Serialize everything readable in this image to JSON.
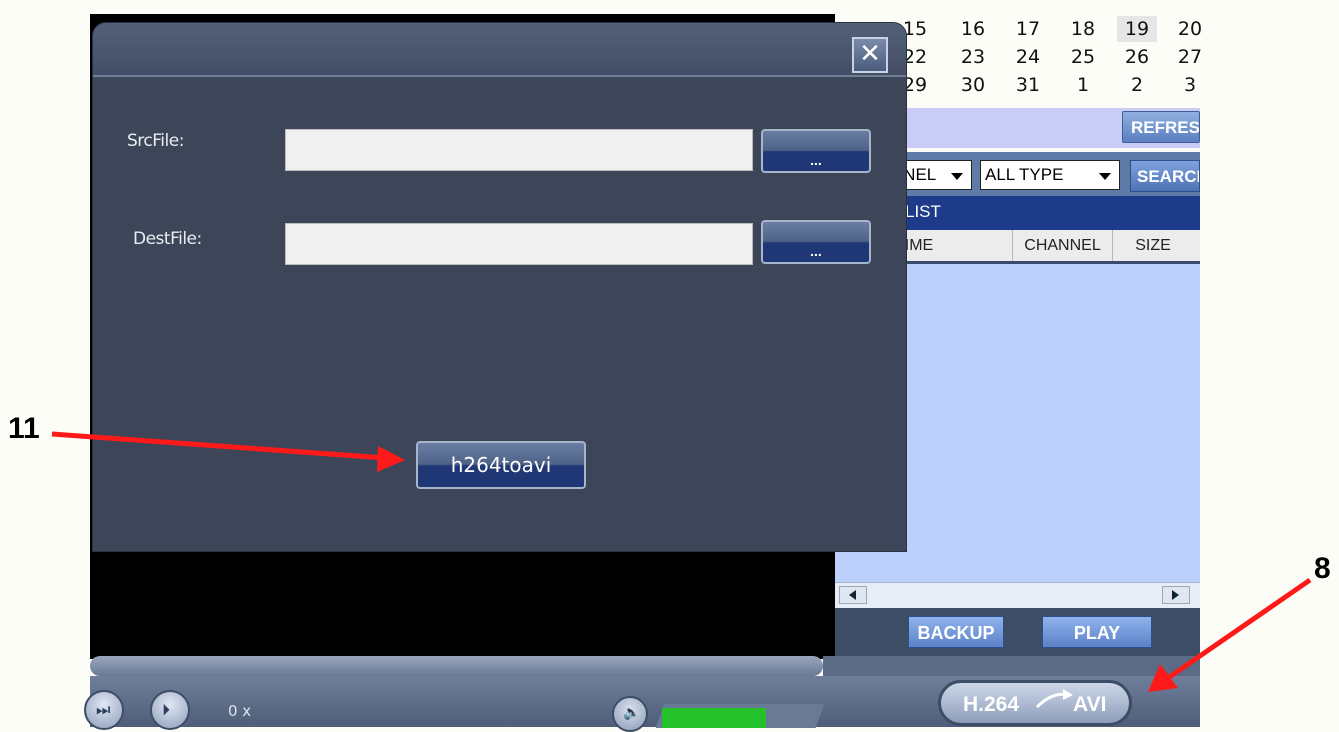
{
  "calendar": {
    "rows": [
      [
        "15",
        "16",
        "17",
        "18",
        "19",
        "20"
      ],
      [
        "22",
        "23",
        "24",
        "25",
        "26",
        "27"
      ],
      [
        "29",
        "30",
        "31",
        "1",
        "2",
        "3"
      ]
    ],
    "selected": "19"
  },
  "right_panel": {
    "refresh_label": "REFRESH",
    "channel_select": "CHANNEL",
    "type_select": "ALL TYPE",
    "search_label": "SEARCH",
    "list_title": "LIST",
    "columns": [
      "TIME",
      "CHANNEL",
      "SIZE"
    ],
    "backup_label": "BACKUP",
    "play_label": "PLAY"
  },
  "player": {
    "speed": "0 x",
    "volume_level": 0.65,
    "convert_left": "H.264",
    "convert_right": "AVI"
  },
  "dialog": {
    "src_label": "SrcFile:",
    "dest_label": "DestFile:",
    "src_value": "",
    "dest_value": "",
    "browse_label": "...",
    "convert_label": "h264toavi",
    "close_glyph": "✕"
  },
  "annotations": {
    "callout_11": "11",
    "callout_8": "8"
  },
  "colors": {
    "arrow": "#ff1a1a",
    "dialog_bg": "#3d4659",
    "volume_fill": "#25c12b",
    "list_bg": "#bcd0fb"
  }
}
